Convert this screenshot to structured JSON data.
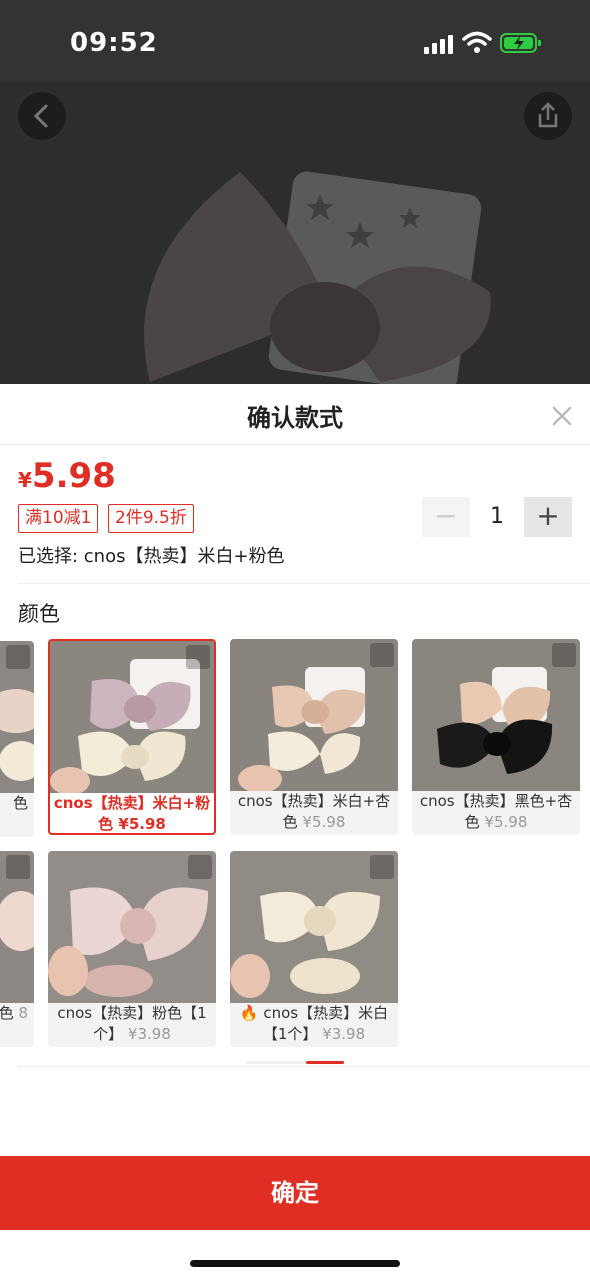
{
  "status": {
    "time": "09:52"
  },
  "sheet": {
    "title": "确认款式",
    "price_currency": "¥",
    "price_value": "5.98",
    "tags": [
      "满10减1",
      "2件9.5折"
    ],
    "quantity": "1",
    "selected_label": "已选择: cnos【热卖】米白+粉色",
    "section_label": "颜色",
    "confirm_label": "确定"
  },
  "variants": [
    {
      "name": "色",
      "price": ""
    },
    {
      "name": "cnos【热卖】米白+粉色",
      "price": "¥5.98"
    },
    {
      "name": "cnos【热卖】米白+杏色",
      "price": "¥5.98"
    },
    {
      "name": "cnos【热卖】黑色+杏色",
      "price": "¥5.98"
    },
    {
      "name": "色",
      "price": "8"
    },
    {
      "name": "cnos【热卖】粉色【1个】",
      "price": "¥3.98"
    },
    {
      "name": "cnos【热卖】米白【1个】",
      "price": "¥3.98"
    }
  ],
  "colors": {
    "accent": "#e02e24"
  }
}
